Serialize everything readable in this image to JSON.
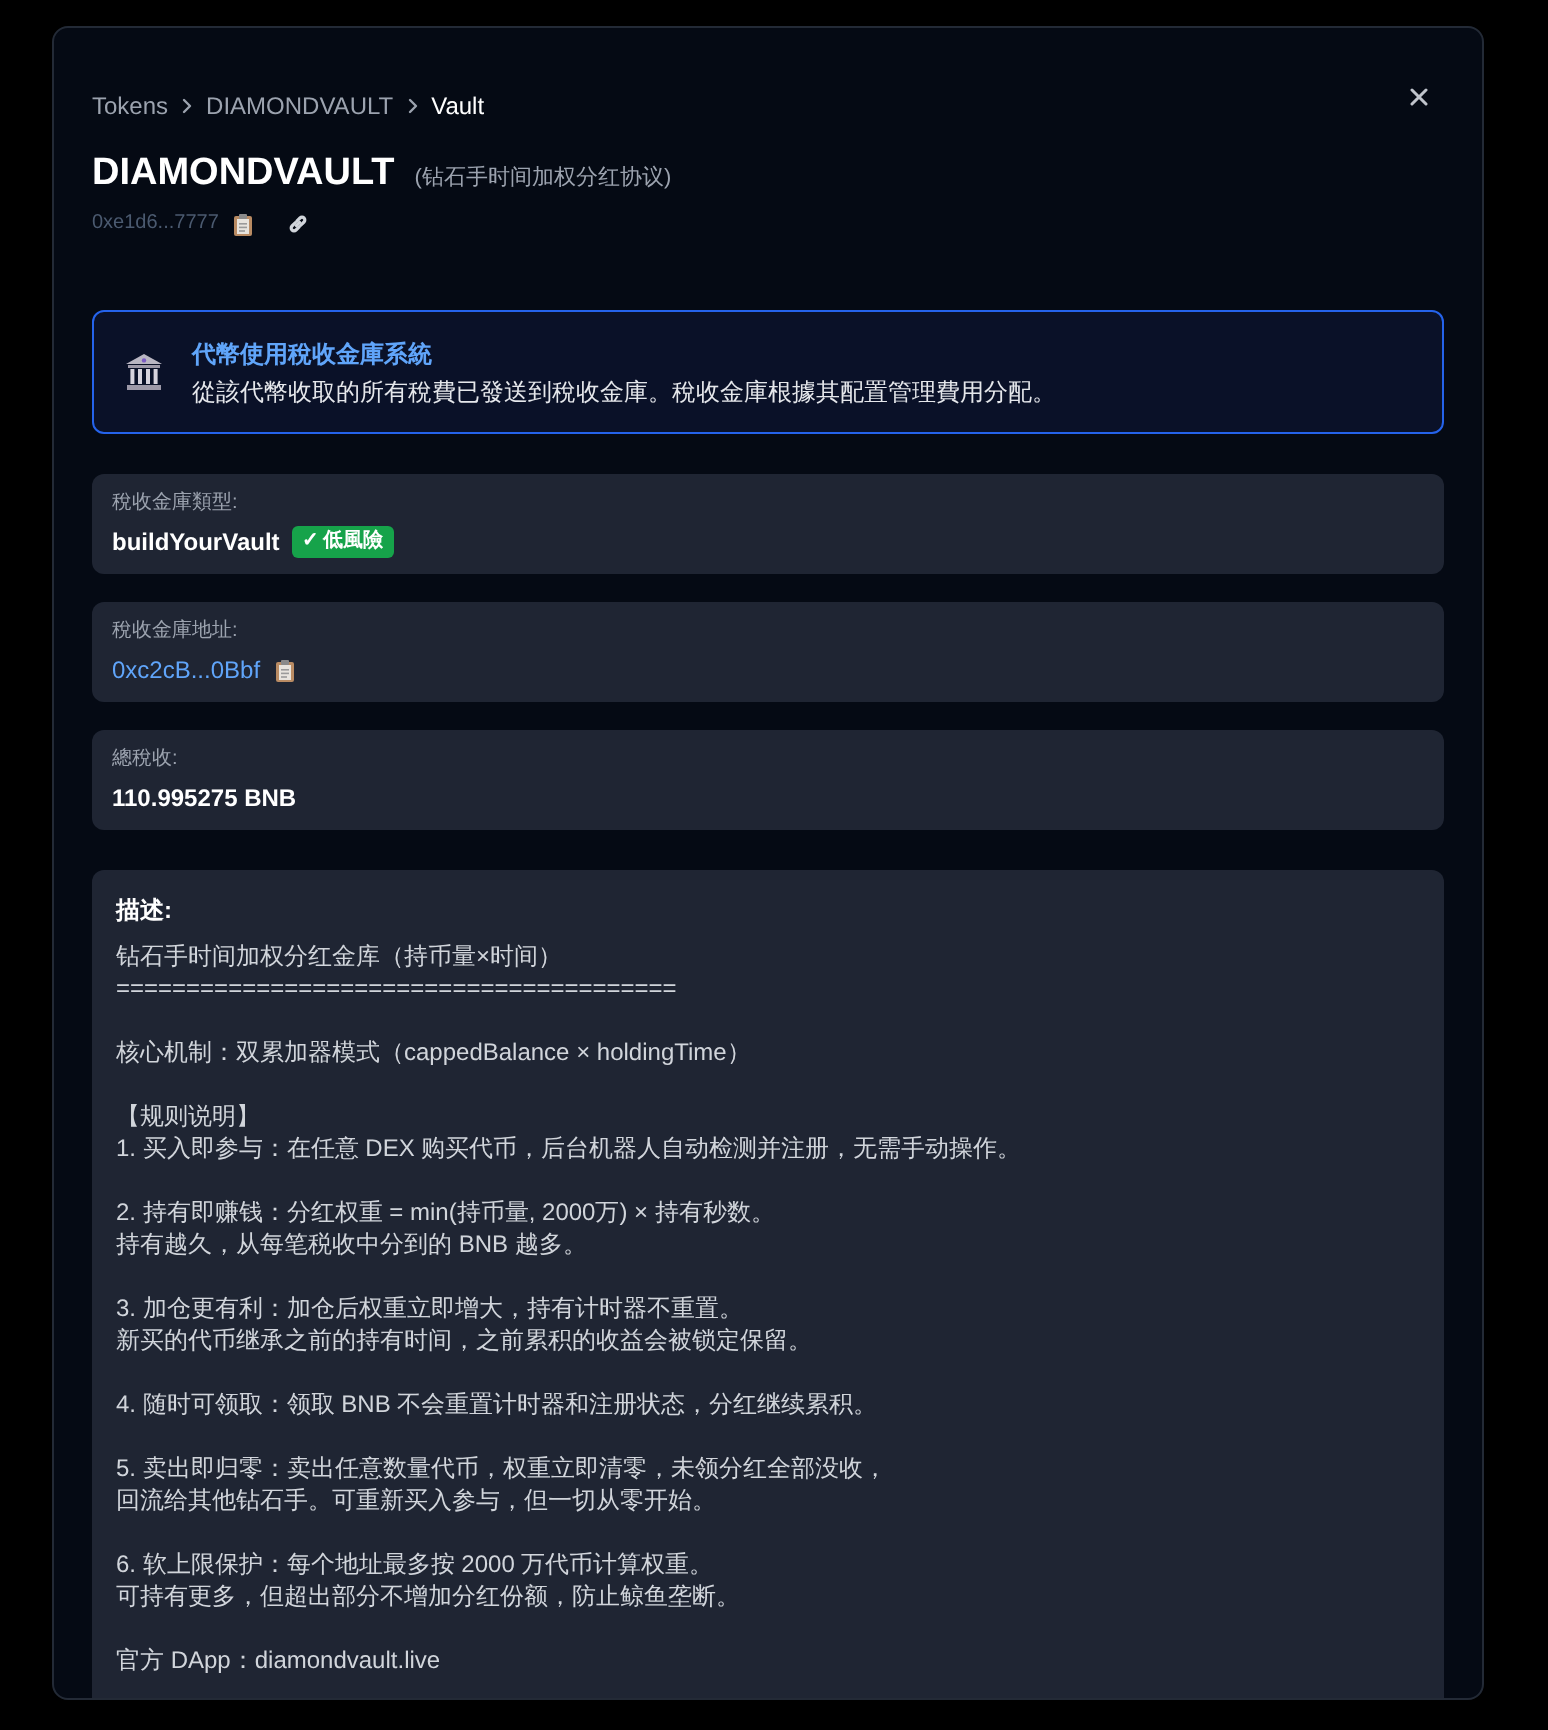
{
  "breadcrumb": [
    {
      "label": "Tokens",
      "current": false
    },
    {
      "label": "DIAMONDVAULT",
      "current": false
    },
    {
      "label": "Vault",
      "current": true
    }
  ],
  "header": {
    "title": "DIAMONDVAULT",
    "subtitle": "(钻石手时间加权分红协议)",
    "address": "0xe1d6...7777"
  },
  "notice": {
    "title": "代幣使用稅收金庫系統",
    "text": "從該代幣收取的所有稅費已發送到稅收金庫。稅收金庫根據其配置管理費用分配。"
  },
  "fields": [
    {
      "kind": "type",
      "label": "稅收金庫類型:",
      "value": "buildYourVault",
      "badge": "✓ 低風險"
    },
    {
      "kind": "address",
      "label": "稅收金庫地址:",
      "value": "0xc2cB...0Bbf"
    },
    {
      "kind": "amount",
      "label": "總稅收:",
      "value": "110.995275 BNB"
    }
  ],
  "description": {
    "label": "描述:",
    "paragraphs": [
      [
        "钻石手时间加权分红金库（持币量×时间）",
        "========================================"
      ],
      [
        "核心机制：双累加器模式（cappedBalance × holdingTime）"
      ],
      [
        "【规则说明】",
        "1. 买入即参与：在任意 DEX 购买代币，后台机器人自动检测并注册，无需手动操作。"
      ],
      [
        "2. 持有即赚钱：分红权重 = min(持币量, 2000万) × 持有秒数。",
        "持有越久，从每笔税收中分到的 BNB 越多。"
      ],
      [
        "3. 加仓更有利：加仓后权重立即增大，持有计时器不重置。",
        "新买的代币继承之前的持有时间，之前累积的收益会被锁定保留。"
      ],
      [
        "4. 随时可领取：领取 BNB 不会重置计时器和注册状态，分红继续累积。"
      ],
      [
        "5. 卖出即归零：卖出任意数量代币，权重立即清零，未领分红全部没收，",
        "回流给其他钻石手。可重新买入参与，但一切从零开始。"
      ],
      [
        "6. 软上限保护：每个地址最多按 2000 万代币计算权重。",
        "可持有更多，但超出部分不增加分红份额，防止鲸鱼垄断。"
      ],
      [
        "官方 DApp：diamondvault.live"
      ]
    ]
  }
}
